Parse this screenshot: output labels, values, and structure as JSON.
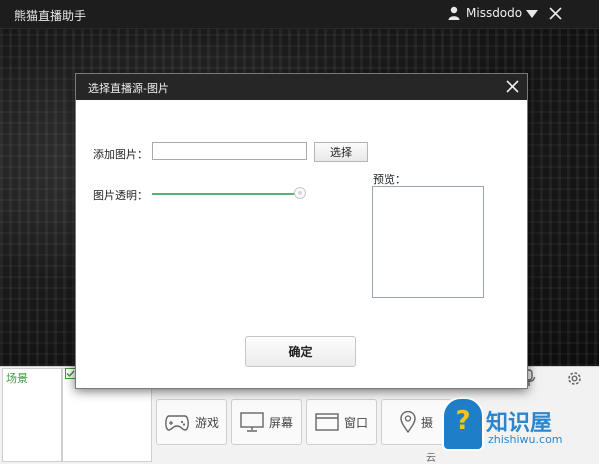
{
  "app": {
    "title": "熊猫直播助手",
    "username": "Missdodo"
  },
  "dialog": {
    "title": "选择直播源-图片",
    "add_image_label": "添加图片：",
    "image_path_value": "",
    "select_button": "选择",
    "transparency_label": "图片透明：",
    "transparency_value": 1.0,
    "preview_label": "预览：",
    "confirm_button": "确定"
  },
  "bottom": {
    "scene_label": "场景",
    "sources": [
      {
        "label": "游戏",
        "icon": "gamepad-icon"
      },
      {
        "label": "屏幕",
        "icon": "monitor-icon"
      },
      {
        "label": "窗口",
        "icon": "window-icon"
      },
      {
        "label": "摄",
        "icon": "location-pin-icon"
      }
    ],
    "cloud_text": "云"
  },
  "watermark": {
    "title": "知识屋",
    "domain": "zhishiwu.com",
    "badge_char": "?"
  },
  "colors": {
    "accent_green": "#53b37a",
    "header_dark": "#262626",
    "watermark_blue": "#2a86cf"
  }
}
